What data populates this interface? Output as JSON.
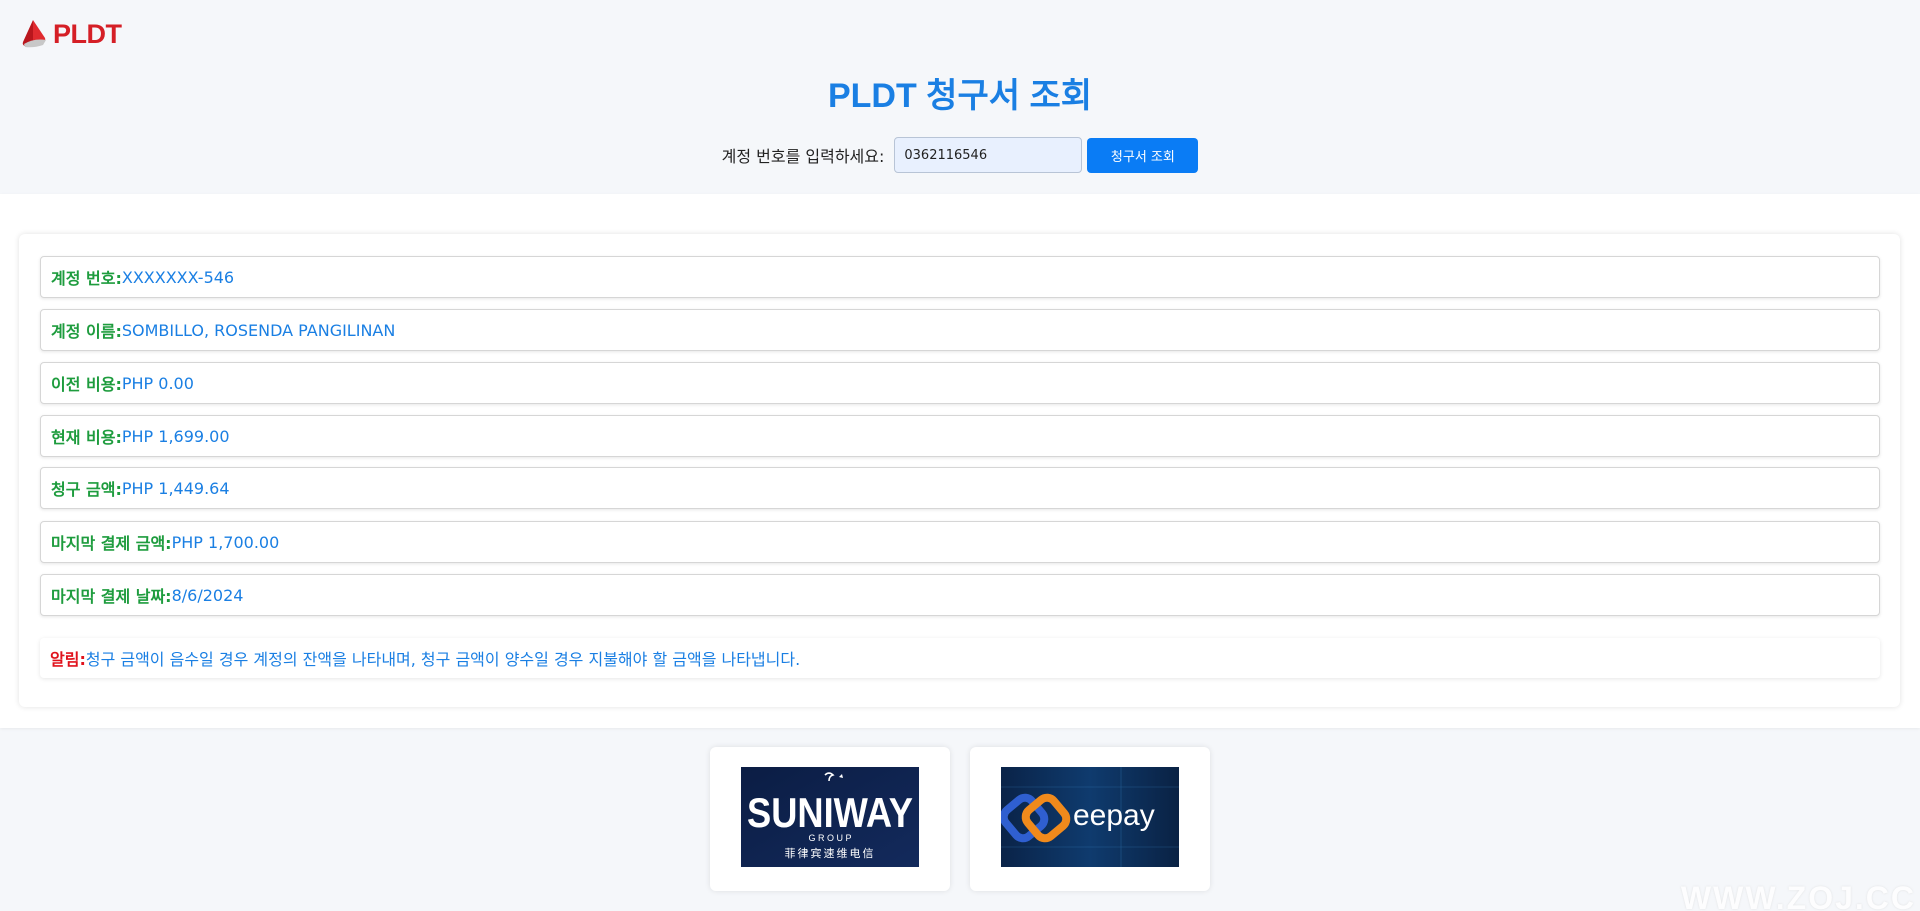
{
  "brand": {
    "logo_text": "PLDT",
    "color": "#d51f26"
  },
  "page": {
    "title": "PLDT 청구서 조회"
  },
  "search": {
    "label": "계정 번호를 입력하세요:",
    "input_value": "0362116546",
    "button_label": "청구서 조회"
  },
  "account": {
    "rows": [
      {
        "label": "계정 번호:",
        "value": "XXXXXXX-546"
      },
      {
        "label": "계정 이름:",
        "value": "SOMBILLO, ROSENDA PANGILINAN"
      },
      {
        "label": "이전 비용:",
        "value": "PHP 0.00"
      },
      {
        "label": "현재 비용:",
        "value": "PHP 1,699.00"
      },
      {
        "label": "청구 금액:",
        "value": "PHP 1,449.64"
      },
      {
        "label": "마지막 결제 금액:",
        "value": "PHP 1,700.00"
      },
      {
        "label": "마지막 결제 날짜:",
        "value": "8/6/2024"
      }
    ]
  },
  "notice": {
    "label": "알림:",
    "text": "청구 금액이 음수일 경우 계정의 잔액을 나타내며, 청구 금액이 양수일 경우 지불해야 할 금액을 나타냅니다."
  },
  "partners": [
    {
      "name": "SUNIWAY",
      "sub": "G R O U P",
      "chinese": "菲律宾速维电信"
    },
    {
      "name": "eepay"
    }
  ],
  "watermark": "WWW.ZOJ.CC",
  "colors": {
    "accent": "#1a7fe3",
    "label_green": "#1e9c3e",
    "alert_red": "#e0121c",
    "button_blue": "#0a7cf5"
  }
}
